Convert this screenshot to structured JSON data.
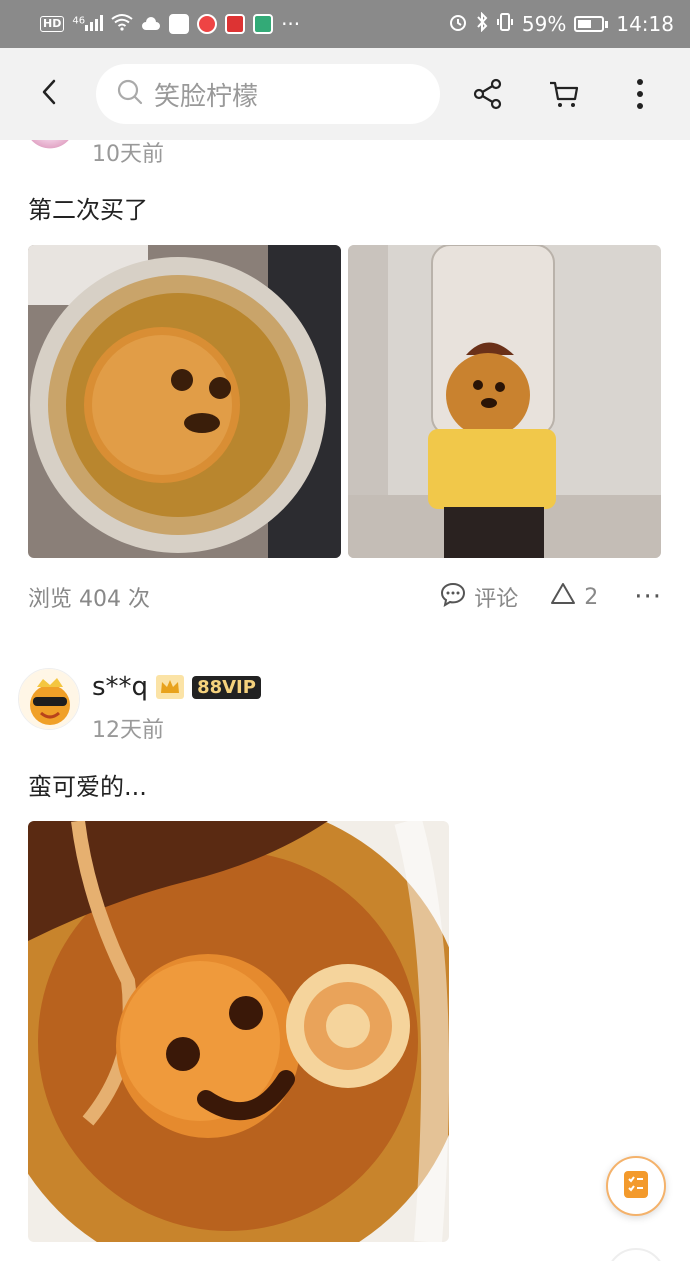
{
  "status_bar": {
    "hd": "HD",
    "network": "46",
    "battery": "59%",
    "time": "14:18",
    "more": "···"
  },
  "header": {
    "search_placeholder": "笑脸柠檬"
  },
  "review1": {
    "time": "10天前",
    "text": "第二次买了",
    "views": "浏览 404 次",
    "comment_label": "评论",
    "like_count": "2",
    "more": "···"
  },
  "review2": {
    "username": "s**q",
    "vip_badge": "88VIP",
    "time": "12天前",
    "text": "蛮可爱的..."
  },
  "colors": {
    "status_bg": "#8a8a8a",
    "topbar_bg": "#f2f2f2",
    "accent": "#ff6a00",
    "vip_text": "#f5d27d"
  },
  "icons": [
    "back-icon",
    "search-icon",
    "share-icon",
    "cart-icon",
    "more-vertical-icon",
    "comment-icon",
    "like-icon",
    "more-icon",
    "checklist-icon"
  ]
}
